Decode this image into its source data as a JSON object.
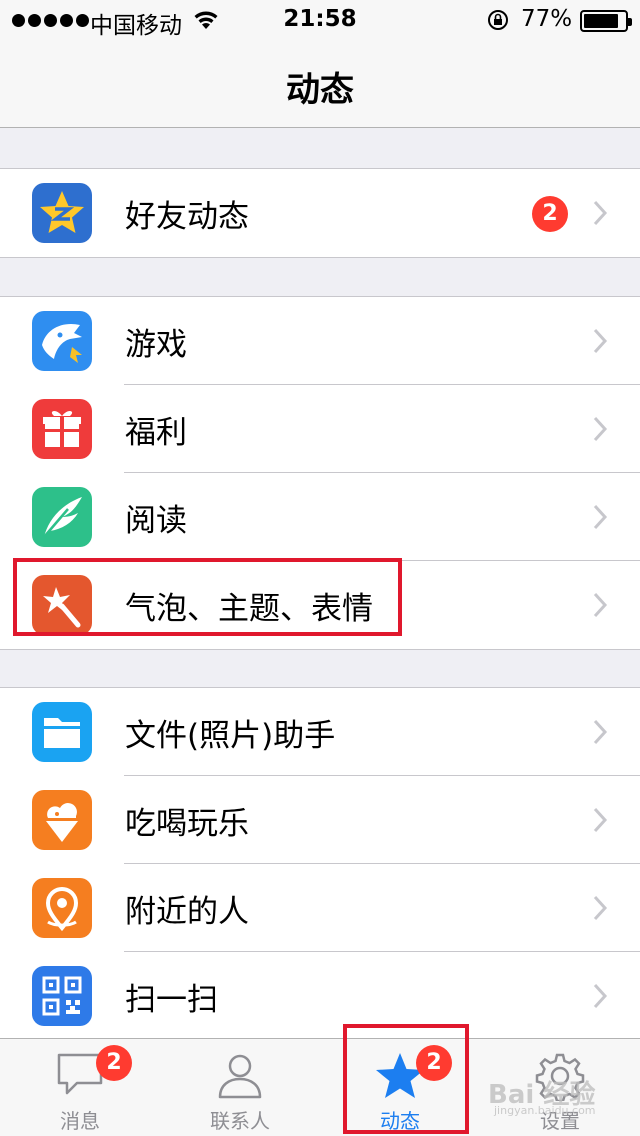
{
  "status_bar": {
    "carrier": "中国移动",
    "time": "21:58",
    "battery_percent": "77%",
    "battery_level": 0.77,
    "icons": [
      "signal-dots-icon",
      "wifi-icon",
      "rotation-lock-icon",
      "battery-icon"
    ]
  },
  "nav": {
    "title": "动态"
  },
  "groups": [
    {
      "items": [
        {
          "label": "好友动态",
          "icon": "qzone-star-icon",
          "badge": "2"
        }
      ]
    },
    {
      "items": [
        {
          "label": "游戏",
          "icon": "game-shark-icon"
        },
        {
          "label": "福利",
          "icon": "gift-icon"
        },
        {
          "label": "阅读",
          "icon": "reading-feather-icon"
        },
        {
          "label": "气泡、主题、表情",
          "icon": "magic-wand-icon"
        }
      ]
    },
    {
      "items": [
        {
          "label": "文件(照片)助手",
          "icon": "folder-icon"
        },
        {
          "label": "吃喝玩乐",
          "icon": "ice-cream-icon"
        },
        {
          "label": "附近的人",
          "icon": "location-pin-icon"
        },
        {
          "label": "扫一扫",
          "icon": "qr-code-icon"
        }
      ]
    }
  ],
  "tabbar": {
    "tabs": [
      {
        "label": "消息",
        "icon": "chat-bubble-icon",
        "badge": "2"
      },
      {
        "label": "联系人",
        "icon": "person-icon"
      },
      {
        "label": "动态",
        "icon": "star-icon",
        "badge": "2",
        "active": true
      },
      {
        "label": "设置",
        "icon": "gear-icon"
      }
    ]
  },
  "watermark": {
    "text": "Bai 经验",
    "sub": "jingyan.baidu.com"
  },
  "colors": {
    "accent": "#1c7ef0",
    "badge": "#ff3b30",
    "highlight": "#e0182d"
  }
}
